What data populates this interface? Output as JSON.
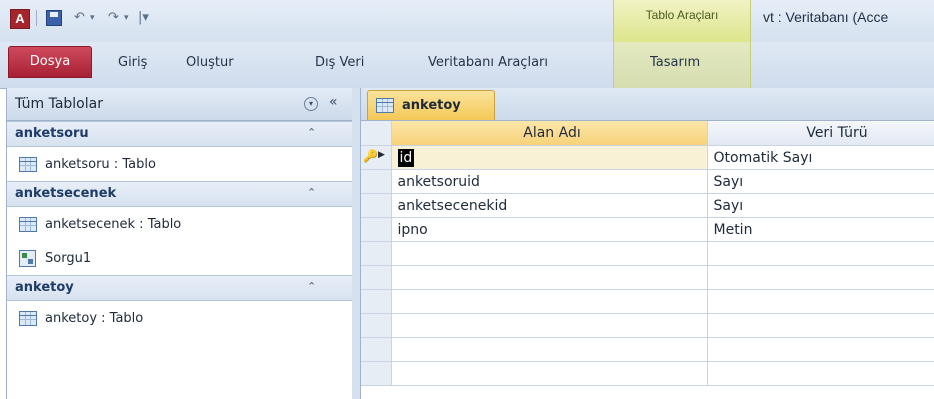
{
  "titlebar": {
    "app_icon_letter": "A",
    "undo_glyph": "↶",
    "redo_glyph": "↷",
    "customize_glyph": "|▾",
    "context_group_label": "Tablo Araçları",
    "window_title": "vt : Veritabanı (Acce"
  },
  "ribbon": {
    "tabs": [
      {
        "label": "Dosya"
      },
      {
        "label": "Giriş"
      },
      {
        "label": "Oluştur"
      },
      {
        "label": "Dış Veri"
      },
      {
        "label": "Veritabanı Araçları"
      },
      {
        "label": "Tasarım"
      }
    ]
  },
  "nav": {
    "title": "Tüm Tablolar",
    "dropdown_glyph": "▾",
    "collapse_glyph": "«",
    "groups": [
      {
        "name": "anketsoru",
        "chevron": "⌃",
        "items": [
          {
            "type": "table",
            "label": "anketsoru : Tablo"
          }
        ]
      },
      {
        "name": "anketsecenek",
        "chevron": "⌃",
        "items": [
          {
            "type": "table",
            "label": "anketsecenek : Tablo"
          },
          {
            "type": "query",
            "label": "Sorgu1"
          }
        ]
      },
      {
        "name": "anketoy",
        "chevron": "⌃",
        "items": [
          {
            "type": "table",
            "label": "anketoy : Tablo"
          }
        ]
      }
    ]
  },
  "document": {
    "tab_label": "anketoy",
    "columns": [
      "Alan Adı",
      "Veri Türü"
    ],
    "rows": [
      {
        "field": "id",
        "type": "Otomatik Sayı",
        "primary_key": true
      },
      {
        "field": "anketsoruid",
        "type": "Sayı"
      },
      {
        "field": "anketsecenekid",
        "type": "Sayı"
      },
      {
        "field": "ipno",
        "type": "Metin"
      }
    ],
    "key_glyph": "🔑",
    "pointer_glyph": "▶"
  },
  "colors": {
    "file_tab": "#c0354a",
    "context_tab": "#dde58c",
    "active_doc_tab": "#f4c856",
    "ribbon_bg": "#d5e1ef"
  }
}
